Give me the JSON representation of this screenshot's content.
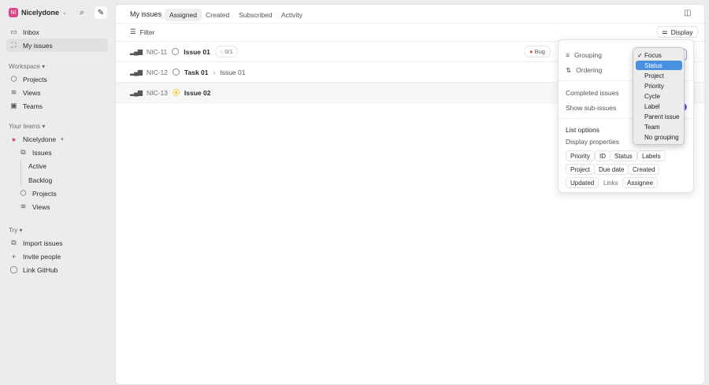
{
  "workspace": {
    "initials": "NI",
    "name": "Nicelydone"
  },
  "sidebar": {
    "top": [
      {
        "label": "Inbox",
        "icon": "inbox-icon"
      },
      {
        "label": "My issues",
        "icon": "my-issues-icon"
      }
    ],
    "workspace_label": "Workspace",
    "workspace_items": [
      {
        "label": "Projects"
      },
      {
        "label": "Views"
      },
      {
        "label": "Teams"
      }
    ],
    "teams_label": "Your teams",
    "team_name": "Nicelydone",
    "team_items": [
      {
        "label": "Issues"
      },
      {
        "label": "Active"
      },
      {
        "label": "Backlog"
      },
      {
        "label": "Projects"
      },
      {
        "label": "Views"
      }
    ],
    "try_label": "Try",
    "try_items": [
      {
        "label": "Import issues"
      },
      {
        "label": "Invite people"
      },
      {
        "label": "Link GitHub"
      }
    ]
  },
  "header": {
    "title": "My issues",
    "tabs": [
      "Assigned",
      "Created",
      "Subscribed",
      "Activity"
    ],
    "active_tab": "Assigned"
  },
  "toolbar": {
    "filter": "Filter",
    "display": "Display"
  },
  "issues": [
    {
      "id": "NIC-11",
      "title": "Issue 01",
      "subissues": "0/1",
      "label": "Bug"
    },
    {
      "id": "NIC-12",
      "title": "Task 01",
      "parent": "Issue 01"
    },
    {
      "id": "NIC-13",
      "title": "Issue 02"
    }
  ],
  "display": {
    "grouping": "Grouping",
    "ordering": "Ordering",
    "completed": "Completed issues",
    "subissues": "Show sub-issues",
    "list_options": "List options",
    "display_properties": "Display properties",
    "properties": [
      {
        "label": "Priority",
        "on": true
      },
      {
        "label": "ID",
        "on": true
      },
      {
        "label": "Status",
        "on": true
      },
      {
        "label": "Labels",
        "on": true
      },
      {
        "label": "Project",
        "on": true
      },
      {
        "label": "Due date",
        "on": true
      },
      {
        "label": "Created",
        "on": true
      },
      {
        "label": "Updated",
        "on": true
      },
      {
        "label": "Links",
        "on": false
      },
      {
        "label": "Assignee",
        "on": true
      }
    ]
  },
  "grouping_options": {
    "checked": "Focus",
    "highlighted": "Status",
    "items": [
      "Focus",
      "Status",
      "Project",
      "Priority",
      "Cycle",
      "Label",
      "Parent issue",
      "Team",
      "No grouping"
    ]
  },
  "colors": {
    "accent": "#4a90e2",
    "workspace": "#e0478a",
    "bug": "#e5484d",
    "in_progress": "#f2c94c"
  }
}
